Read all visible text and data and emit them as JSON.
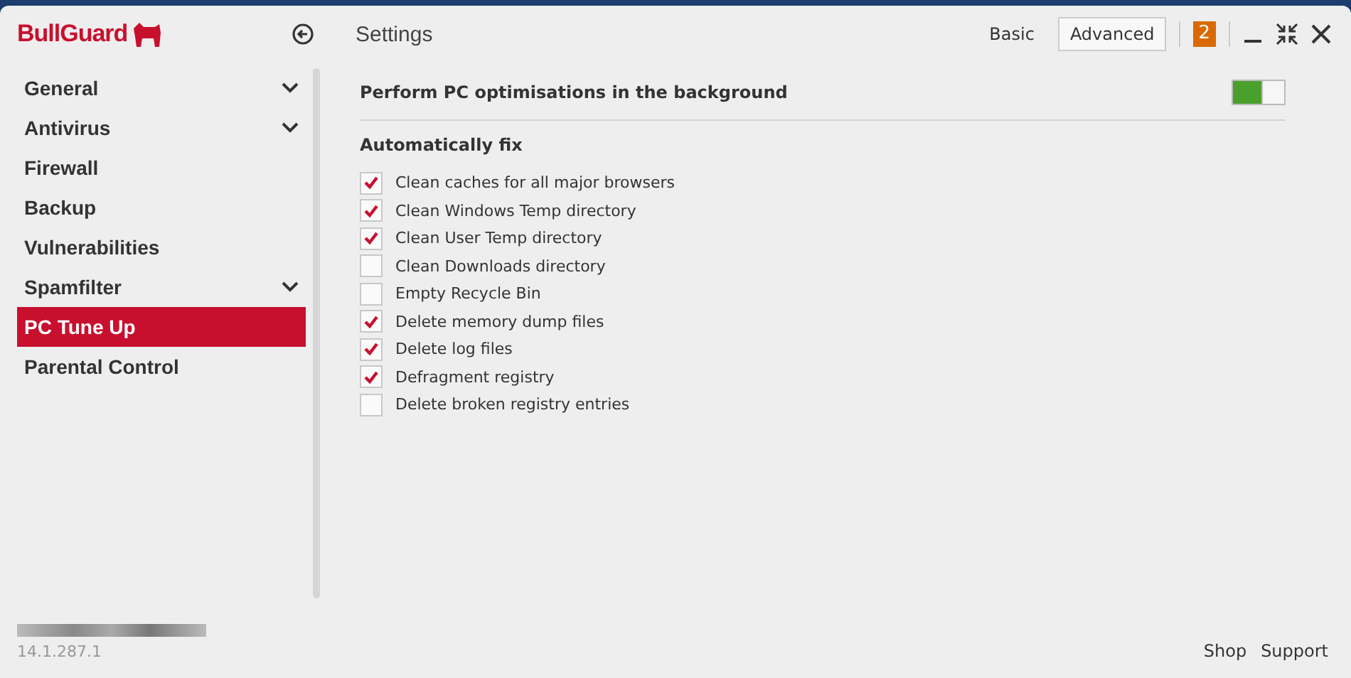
{
  "app": {
    "logo": "BullGuard",
    "title": "Settings"
  },
  "modes": [
    {
      "label": "Basic",
      "selected": false
    },
    {
      "label": "Advanced",
      "selected": true
    }
  ],
  "notifications": {
    "count": "2"
  },
  "sidebar": {
    "items": [
      {
        "label": "General",
        "has_submenu": true,
        "selected": false
      },
      {
        "label": "Antivirus",
        "has_submenu": true,
        "selected": false
      },
      {
        "label": "Firewall",
        "has_submenu": false,
        "selected": false
      },
      {
        "label": "Backup",
        "has_submenu": false,
        "selected": false
      },
      {
        "label": "Vulnerabilities",
        "has_submenu": false,
        "selected": false
      },
      {
        "label": "Spamfilter",
        "has_submenu": true,
        "selected": false
      },
      {
        "label": "PC Tune Up",
        "has_submenu": false,
        "selected": true
      },
      {
        "label": "Parental Control",
        "has_submenu": false,
        "selected": false
      }
    ]
  },
  "setting": {
    "label": "Perform PC optimisations in the background",
    "on": true
  },
  "section": {
    "title": "Automatically fix",
    "options": [
      {
        "label": "Clean caches for all major browsers",
        "checked": true
      },
      {
        "label": "Clean Windows Temp directory",
        "checked": true
      },
      {
        "label": "Clean User Temp directory",
        "checked": true
      },
      {
        "label": "Clean Downloads directory",
        "checked": false
      },
      {
        "label": "Empty Recycle Bin",
        "checked": false
      },
      {
        "label": "Delete memory dump files",
        "checked": true
      },
      {
        "label": "Delete log files",
        "checked": true
      },
      {
        "label": "Defragment registry",
        "checked": true
      },
      {
        "label": "Delete broken registry entries",
        "checked": false
      }
    ]
  },
  "footer": {
    "version": "14.1.287.1",
    "links": [
      "Shop",
      "Support"
    ]
  }
}
